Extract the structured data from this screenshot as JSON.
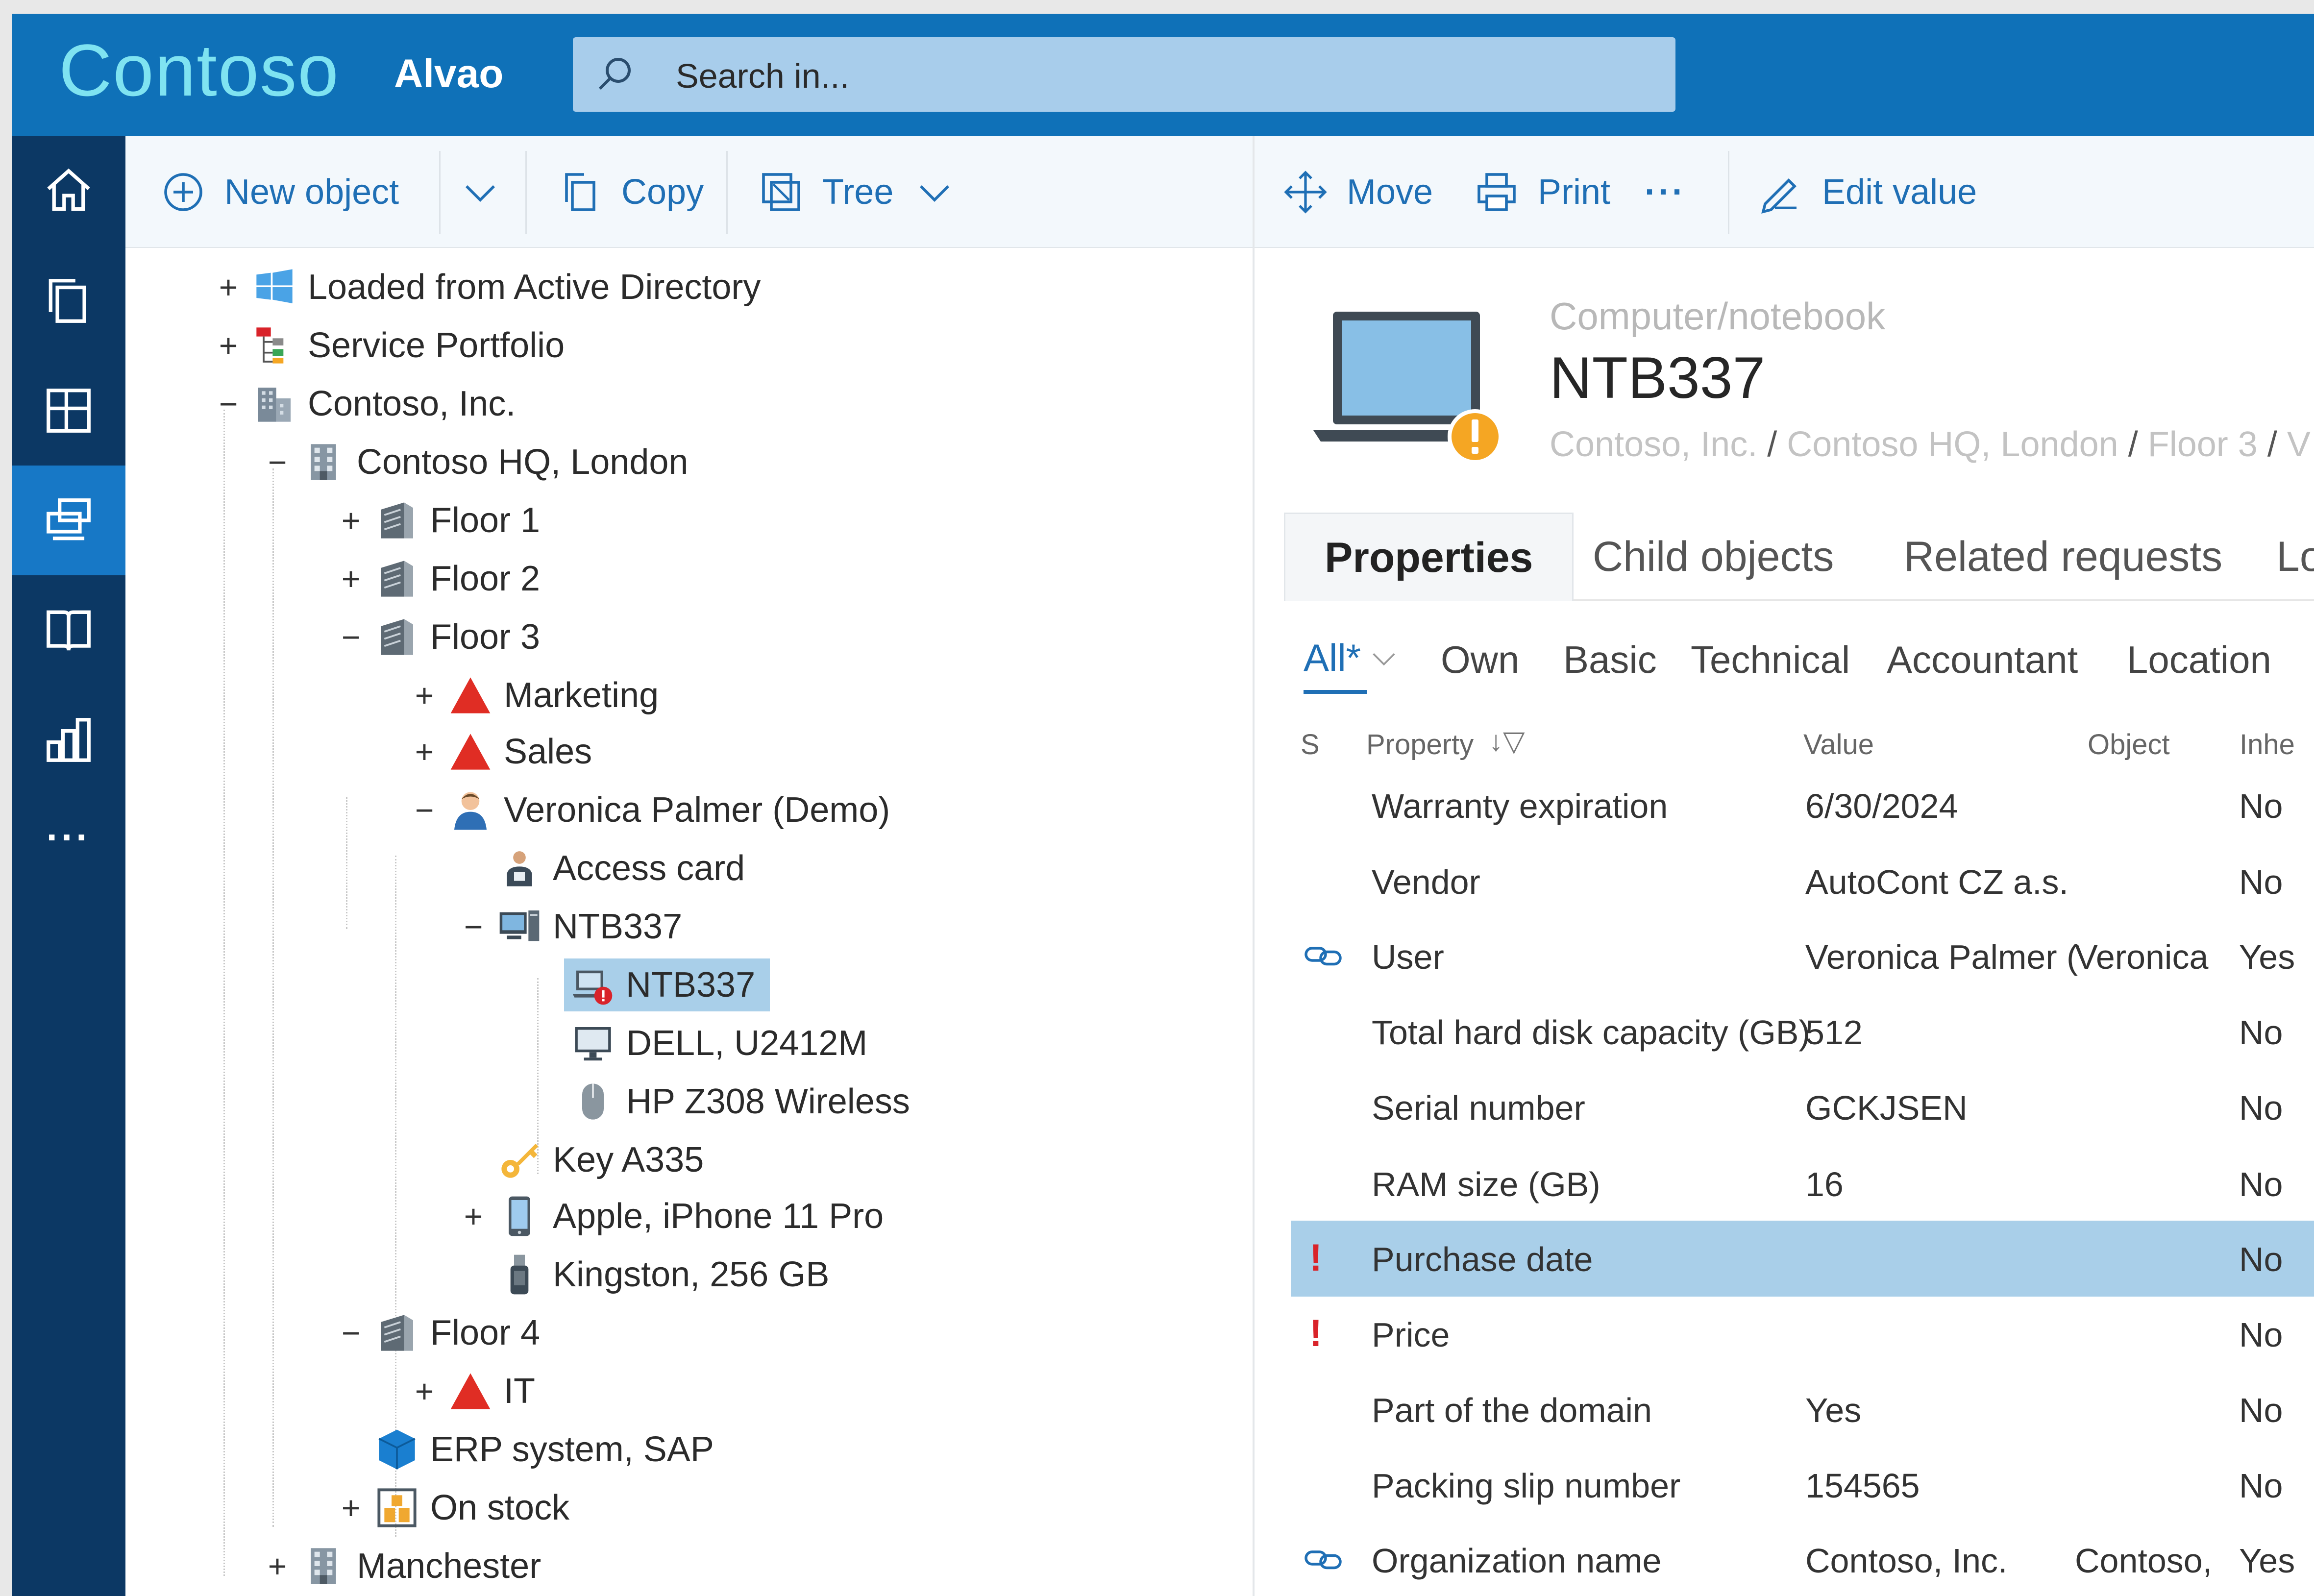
{
  "header": {
    "brand": "Contoso",
    "product": "Alvao",
    "search_placeholder": "Search in..."
  },
  "rail": {
    "items": [
      "home-icon",
      "copy-pages-icon",
      "dashboard-icon",
      "assets-icon",
      "book-icon",
      "reports-icon",
      "more-icon"
    ],
    "more_label": "..."
  },
  "toolbar": {
    "new_object": "New object",
    "copy": "Copy",
    "tree": "Tree",
    "move": "Move",
    "print": "Print",
    "more": "···",
    "edit_value": "Edit value"
  },
  "tree": {
    "nodes": [
      {
        "label": "Loaded from Active Directory",
        "toggle": "+",
        "icon": "windows-icon"
      },
      {
        "label": "Service Portfolio",
        "toggle": "+",
        "icon": "hierarchy-icon"
      },
      {
        "label": "Contoso, Inc.",
        "toggle": "−",
        "icon": "company-icon"
      },
      {
        "label": "Contoso HQ, London",
        "toggle": "−",
        "icon": "building-icon"
      },
      {
        "label": "Floor 1",
        "toggle": "+",
        "icon": "floor-icon"
      },
      {
        "label": "Floor 2",
        "toggle": "+",
        "icon": "floor-icon"
      },
      {
        "label": "Floor 3",
        "toggle": "−",
        "icon": "floor-icon"
      },
      {
        "label": "Marketing",
        "toggle": "+",
        "icon": "department-icon"
      },
      {
        "label": "Sales",
        "toggle": "+",
        "icon": "department-icon"
      },
      {
        "label": "Veronica Palmer (Demo)",
        "toggle": "−",
        "icon": "person-icon"
      },
      {
        "label": "Access card",
        "toggle": "",
        "icon": "access-card-icon"
      },
      {
        "label": "NTB337",
        "toggle": "−",
        "icon": "workstation-icon"
      },
      {
        "label": "NTB337",
        "toggle": "",
        "icon": "notebook-warning-icon"
      },
      {
        "label": "DELL, U2412M",
        "toggle": "",
        "icon": "monitor-icon"
      },
      {
        "label": "HP Z308 Wireless",
        "toggle": "",
        "icon": "mouse-icon"
      },
      {
        "label": "Key A335",
        "toggle": "",
        "icon": "key-icon"
      },
      {
        "label": "Apple, iPhone 11 Pro",
        "toggle": "+",
        "icon": "phone-icon"
      },
      {
        "label": "Kingston, 256 GB",
        "toggle": "",
        "icon": "usb-drive-icon"
      },
      {
        "label": "Floor 4",
        "toggle": "−",
        "icon": "floor-icon"
      },
      {
        "label": "IT",
        "toggle": "+",
        "icon": "department-icon"
      },
      {
        "label": "ERP system, SAP",
        "toggle": "",
        "icon": "cube-icon"
      },
      {
        "label": "On stock",
        "toggle": "+",
        "icon": "stock-icon"
      },
      {
        "label": "Manchester",
        "toggle": "+",
        "icon": "building-icon"
      }
    ]
  },
  "detail": {
    "object_class": "Computer/notebook",
    "object_name": "NTB337",
    "breadcrumb": [
      "Contoso, Inc.",
      "Contoso HQ, London",
      "Floor 3",
      "V"
    ],
    "warning_badge": "!",
    "tabs": [
      "Properties",
      "Child objects",
      "Related requests",
      "Lo"
    ],
    "filters": [
      "All*",
      "Own",
      "Basic",
      "Technical",
      "Accountant",
      "Location"
    ],
    "columns": {
      "s": "S",
      "property": "Property",
      "value": "Value",
      "object": "Object",
      "inherited": "Inhe"
    },
    "rows": [
      {
        "mark": "",
        "property": "Warranty expiration",
        "value": "6/30/2024",
        "object": "",
        "inherited": "No"
      },
      {
        "mark": "",
        "property": "Vendor",
        "value": "AutoCont CZ a.s.",
        "object": "",
        "inherited": "No"
      },
      {
        "mark": "link",
        "property": "User",
        "value": "Veronica Palmer (",
        "object": "Veronica",
        "inherited": "Yes"
      },
      {
        "mark": "",
        "property": "Total hard disk capacity (GB)",
        "value": "512",
        "object": "",
        "inherited": "No"
      },
      {
        "mark": "",
        "property": "Serial number",
        "value": "GCKJSEN",
        "object": "",
        "inherited": "No"
      },
      {
        "mark": "",
        "property": "RAM size (GB)",
        "value": "16",
        "object": "",
        "inherited": "No"
      },
      {
        "mark": "!",
        "property": "Purchase date",
        "value": "",
        "object": "",
        "inherited": "No"
      },
      {
        "mark": "!",
        "property": "Price",
        "value": "",
        "object": "",
        "inherited": "No"
      },
      {
        "mark": "",
        "property": "Part of the domain",
        "value": "Yes",
        "object": "",
        "inherited": "No"
      },
      {
        "mark": "",
        "property": "Packing slip number",
        "value": "154565",
        "object": "",
        "inherited": "No"
      },
      {
        "mark": "link",
        "property": "Organization name",
        "value": "Contoso, Inc.",
        "object": "Contoso,",
        "inherited": "Yes"
      }
    ]
  },
  "colors": {
    "topbar": "#0f71b8",
    "rail": "#0c3864",
    "rail_active": "#1778c6",
    "accent": "#1f6fb5",
    "selection": "#a9cfe9",
    "warning": "#f5a623",
    "alert": "#d9232a"
  }
}
